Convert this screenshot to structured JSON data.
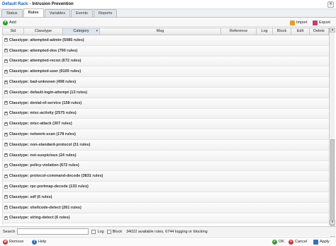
{
  "breadcrumb": {
    "root": "Default Rack",
    "separator": "›",
    "current": "Intrusion Prevention"
  },
  "tabs": [
    {
      "label": "Status"
    },
    {
      "label": "Rules"
    },
    {
      "label": "Variables"
    },
    {
      "label": "Events"
    },
    {
      "label": "Reports"
    }
  ],
  "toolbar": {
    "add": "Add",
    "import": "Import",
    "export": "Export"
  },
  "columns": [
    "Sid",
    "Classtype",
    "Category",
    "Msg",
    "Reference",
    "Log",
    "Block",
    "Edit",
    "Delete"
  ],
  "groups": [
    "Classtype: attempted-admin (5085 rules)",
    "Classtype: attempted-dos (790 rules)",
    "Classtype: attempted-recon (672 rules)",
    "Classtype: attempted-user (9100 rules)",
    "Classtype: bad-unknown (498 rules)",
    "Classtype: default-login-attempt (13 rules)",
    "Classtype: denial-of-service (158 rules)",
    "Classtype: misc-activity (2575 rules)",
    "Classtype: misc-attack (307 rules)",
    "Classtype: network-scan (178 rules)",
    "Classtype: non-standard-protocol (31 rules)",
    "Classtype: not-suspicious (24 rules)",
    "Classtype: policy-violation (672 rules)",
    "Classtype: protocol-command-decode (3831 rules)",
    "Classtype: rpc-portmap-decode (133 rules)",
    "Classtype: sdf (6 rules)",
    "Classtype: shellcode-detect (261 rules)",
    "Classtype: string-detect (6 rules)"
  ],
  "statusbar": {
    "search_label": "Search",
    "log_label": "Log",
    "block_label": "Block",
    "summary": "34022 available rules, 6744 logging or blocking"
  },
  "footer": {
    "remove": "Remove",
    "help": "Help",
    "ok": "OK",
    "cancel": "Cancel",
    "apply": "Apply"
  }
}
